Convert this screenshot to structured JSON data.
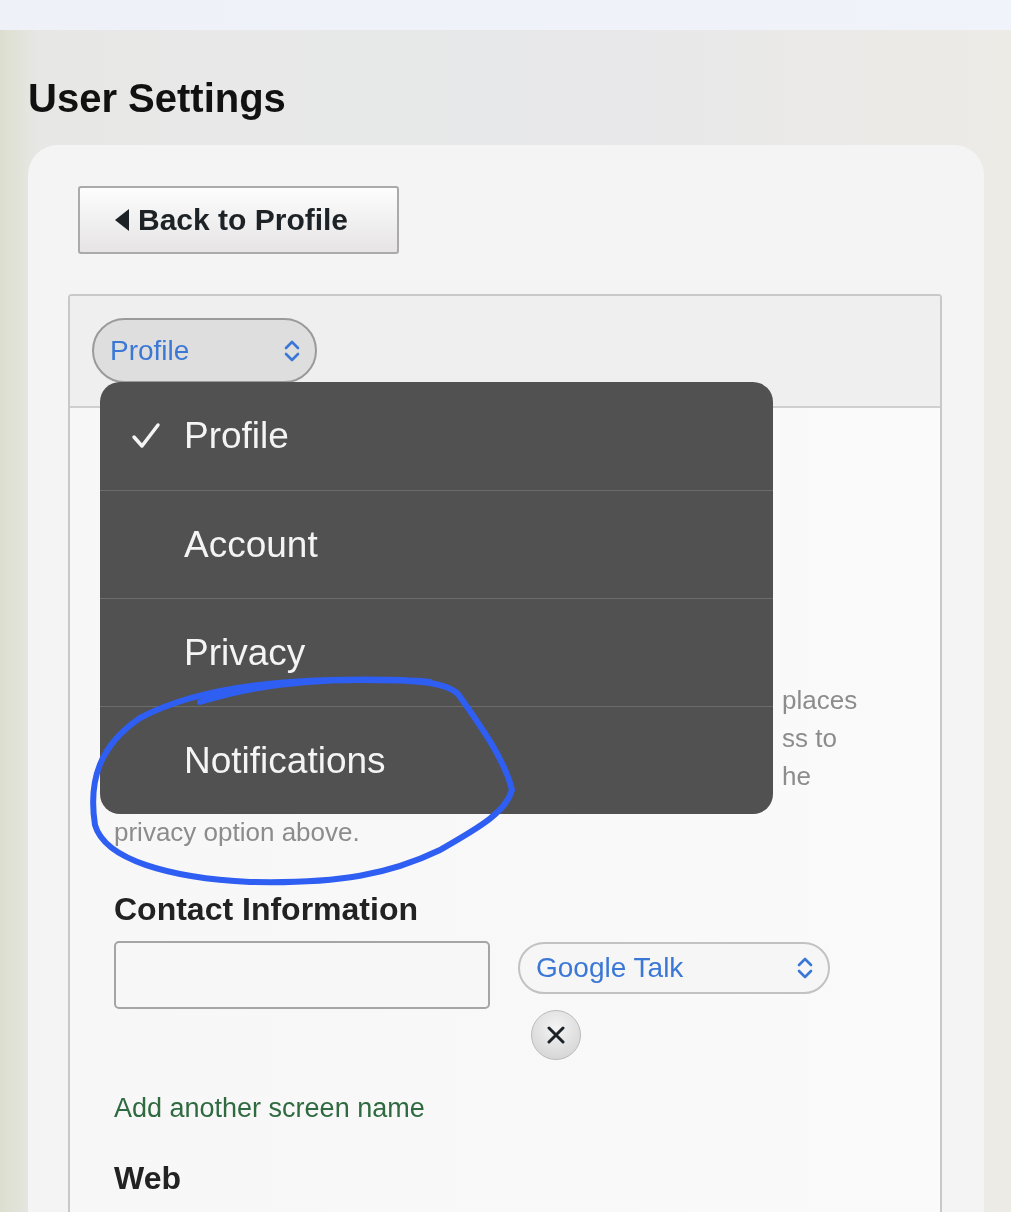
{
  "page": {
    "title": "User Settings"
  },
  "back_button": {
    "label": "Back to Profile"
  },
  "section_select": {
    "value": "Profile"
  },
  "section_menu": {
    "items": [
      {
        "label": "Profile",
        "selected": true
      },
      {
        "label": "Account",
        "selected": false
      },
      {
        "label": "Privacy",
        "selected": false
      },
      {
        "label": "Notifications",
        "selected": false
      }
    ]
  },
  "description_fragments": [
    "places",
    "ss to",
    "he",
    "privacy option above."
  ],
  "contact": {
    "heading": "Contact Information",
    "service_select": {
      "value": "Google Talk"
    },
    "add_link": "Add another screen name"
  },
  "web": {
    "heading": "Web"
  }
}
